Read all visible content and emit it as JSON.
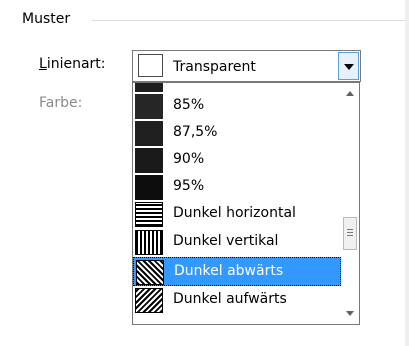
{
  "group": {
    "title": "Muster"
  },
  "fields": {
    "linienart_mnemonic": "L",
    "linienart_rest": "inienart:",
    "farbe_label": "Farbe:"
  },
  "combo": {
    "value": "Transparent"
  },
  "dropdown": {
    "items": [
      {
        "label": "",
        "swatch": "solid"
      },
      {
        "label": "85%",
        "swatch": "85"
      },
      {
        "label": "87,5%",
        "swatch": "875"
      },
      {
        "label": "90%",
        "swatch": "90"
      },
      {
        "label": "95%",
        "swatch": "95"
      },
      {
        "label": "Dunkel horizontal",
        "swatch": "h"
      },
      {
        "label": "Dunkel vertikal",
        "swatch": "v"
      },
      {
        "label": "Dunkel abwärts",
        "swatch": "down",
        "selected": true
      },
      {
        "label": "Dunkel aufwärts",
        "swatch": "up"
      }
    ]
  },
  "colors": {
    "selection": "#3399ff",
    "combo_button": "#e6f1fb"
  },
  "icons": {
    "combo_button": "chevron-down-icon",
    "scroll_up": "arrow-up-icon",
    "scroll_down": "arrow-down-icon"
  }
}
